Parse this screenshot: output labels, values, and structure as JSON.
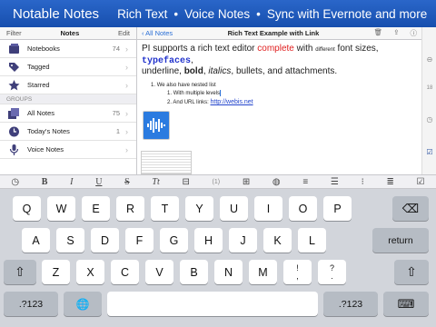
{
  "banner": {
    "brand": "Notable Notes",
    "features": [
      "Rich Text",
      "Voice Notes",
      "Sync with Evernote and more"
    ],
    "separator": "•"
  },
  "sidebar": {
    "header": {
      "left": "Filter",
      "title": "Notes",
      "right": "Edit"
    },
    "items": [
      {
        "label": "Notebooks",
        "count": "74",
        "icon": "notebook-icon"
      },
      {
        "label": "Tagged",
        "count": "",
        "icon": "tag-icon"
      },
      {
        "label": "Starred",
        "count": "",
        "icon": "star-icon"
      }
    ],
    "group_label": "GROUPS",
    "groups": [
      {
        "label": "All Notes",
        "count": "75",
        "icon": "notes-stack-icon"
      },
      {
        "label": "Today's Notes",
        "count": "1",
        "icon": "clock-icon"
      },
      {
        "label": "Voice Notes",
        "count": "",
        "icon": "microphone-icon"
      }
    ],
    "chevron": "›"
  },
  "editor": {
    "back_label": "‹ All Notes",
    "title": "Rich Text Example with Link",
    "tool_icons": [
      "trash-icon",
      "share-icon",
      "info-icon"
    ],
    "tool_glyphs": [
      "🗑",
      "⇪",
      "ⓘ"
    ],
    "body": {
      "p1": "PI supports a rich text editor ",
      "p1_red": "complete",
      "p1_b": " with ",
      "p1_small": "different",
      "p1_c": " font sizes, ",
      "p1_mono": "typefaces",
      "p1_d": ",",
      "p2_a": "underline, ",
      "p2_bold": "bold",
      "p2_b": ", ",
      "p2_italic": "italics",
      "p2_c": ", bullets, and attachments.",
      "list_num1": "1.",
      "list1": "We also have nested list",
      "list_num2": "1.",
      "list2": "With multiple levels",
      "list_num3": "2.",
      "list3": "And URL links: ",
      "link": "http://webis.net"
    }
  },
  "strip": {
    "icons": [
      "settings-icon",
      "calendar-icon",
      "clock-icon",
      "checkbox-icon"
    ],
    "glyphs": [
      "⊖",
      "18",
      "◷",
      "☑"
    ]
  },
  "format_toolbar": {
    "items": [
      {
        "glyph": "◷",
        "icon": "clock-icon"
      },
      {
        "glyph": "B",
        "icon": "bold-icon"
      },
      {
        "glyph": "I",
        "icon": "italic-icon"
      },
      {
        "glyph": "U",
        "icon": "underline-icon"
      },
      {
        "glyph": "S",
        "icon": "strikethrough-icon"
      },
      {
        "glyph": "Tt",
        "icon": "font-size-icon"
      },
      {
        "glyph": "⊟",
        "icon": "decrease-icon"
      },
      {
        "glyph": "(1)",
        "icon": "font-size-value"
      },
      {
        "glyph": "⊞",
        "icon": "increase-icon"
      },
      {
        "glyph": "◍",
        "icon": "color-fill-icon"
      },
      {
        "glyph": "≡",
        "icon": "align-left-icon"
      },
      {
        "glyph": "☰",
        "icon": "align-center-icon"
      },
      {
        "glyph": "⁝",
        "icon": "bullet-list-icon"
      },
      {
        "glyph": "≣",
        "icon": "numbered-list-icon"
      },
      {
        "glyph": "☑",
        "icon": "checklist-icon"
      }
    ]
  },
  "keyboard": {
    "row1": [
      "Q",
      "W",
      "E",
      "R",
      "T",
      "Y",
      "U",
      "I",
      "O",
      "P"
    ],
    "row2": [
      "A",
      "S",
      "D",
      "F",
      "G",
      "H",
      "J",
      "K",
      "L"
    ],
    "row3": [
      "Z",
      "X",
      "C",
      "V",
      "B",
      "N",
      "M",
      "!",
      ",",
      "?",
      "."
    ],
    "row3_alt": [
      "",
      "",
      "",
      "",
      "",
      "",
      "",
      "",
      ".",
      "",
      ""
    ],
    "backspace": "⌫",
    "return": "return",
    "shift": "⇧",
    "numbers": ".?123",
    "globe": "🌐",
    "hide": "⌨"
  }
}
